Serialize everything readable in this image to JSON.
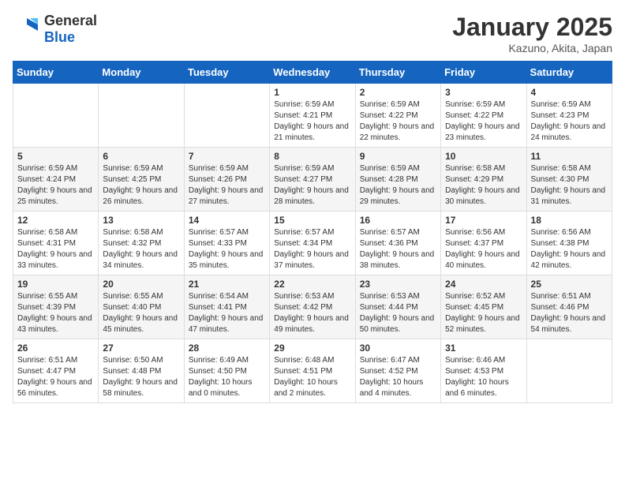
{
  "header": {
    "logo_general": "General",
    "logo_blue": "Blue",
    "title": "January 2025",
    "subtitle": "Kazuno, Akita, Japan"
  },
  "weekdays": [
    "Sunday",
    "Monday",
    "Tuesday",
    "Wednesday",
    "Thursday",
    "Friday",
    "Saturday"
  ],
  "weeks": [
    [
      {
        "day": "",
        "info": ""
      },
      {
        "day": "",
        "info": ""
      },
      {
        "day": "",
        "info": ""
      },
      {
        "day": "1",
        "info": "Sunrise: 6:59 AM\nSunset: 4:21 PM\nDaylight: 9 hours and 21 minutes."
      },
      {
        "day": "2",
        "info": "Sunrise: 6:59 AM\nSunset: 4:22 PM\nDaylight: 9 hours and 22 minutes."
      },
      {
        "day": "3",
        "info": "Sunrise: 6:59 AM\nSunset: 4:22 PM\nDaylight: 9 hours and 23 minutes."
      },
      {
        "day": "4",
        "info": "Sunrise: 6:59 AM\nSunset: 4:23 PM\nDaylight: 9 hours and 24 minutes."
      }
    ],
    [
      {
        "day": "5",
        "info": "Sunrise: 6:59 AM\nSunset: 4:24 PM\nDaylight: 9 hours and 25 minutes."
      },
      {
        "day": "6",
        "info": "Sunrise: 6:59 AM\nSunset: 4:25 PM\nDaylight: 9 hours and 26 minutes."
      },
      {
        "day": "7",
        "info": "Sunrise: 6:59 AM\nSunset: 4:26 PM\nDaylight: 9 hours and 27 minutes."
      },
      {
        "day": "8",
        "info": "Sunrise: 6:59 AM\nSunset: 4:27 PM\nDaylight: 9 hours and 28 minutes."
      },
      {
        "day": "9",
        "info": "Sunrise: 6:59 AM\nSunset: 4:28 PM\nDaylight: 9 hours and 29 minutes."
      },
      {
        "day": "10",
        "info": "Sunrise: 6:58 AM\nSunset: 4:29 PM\nDaylight: 9 hours and 30 minutes."
      },
      {
        "day": "11",
        "info": "Sunrise: 6:58 AM\nSunset: 4:30 PM\nDaylight: 9 hours and 31 minutes."
      }
    ],
    [
      {
        "day": "12",
        "info": "Sunrise: 6:58 AM\nSunset: 4:31 PM\nDaylight: 9 hours and 33 minutes."
      },
      {
        "day": "13",
        "info": "Sunrise: 6:58 AM\nSunset: 4:32 PM\nDaylight: 9 hours and 34 minutes."
      },
      {
        "day": "14",
        "info": "Sunrise: 6:57 AM\nSunset: 4:33 PM\nDaylight: 9 hours and 35 minutes."
      },
      {
        "day": "15",
        "info": "Sunrise: 6:57 AM\nSunset: 4:34 PM\nDaylight: 9 hours and 37 minutes."
      },
      {
        "day": "16",
        "info": "Sunrise: 6:57 AM\nSunset: 4:36 PM\nDaylight: 9 hours and 38 minutes."
      },
      {
        "day": "17",
        "info": "Sunrise: 6:56 AM\nSunset: 4:37 PM\nDaylight: 9 hours and 40 minutes."
      },
      {
        "day": "18",
        "info": "Sunrise: 6:56 AM\nSunset: 4:38 PM\nDaylight: 9 hours and 42 minutes."
      }
    ],
    [
      {
        "day": "19",
        "info": "Sunrise: 6:55 AM\nSunset: 4:39 PM\nDaylight: 9 hours and 43 minutes."
      },
      {
        "day": "20",
        "info": "Sunrise: 6:55 AM\nSunset: 4:40 PM\nDaylight: 9 hours and 45 minutes."
      },
      {
        "day": "21",
        "info": "Sunrise: 6:54 AM\nSunset: 4:41 PM\nDaylight: 9 hours and 47 minutes."
      },
      {
        "day": "22",
        "info": "Sunrise: 6:53 AM\nSunset: 4:42 PM\nDaylight: 9 hours and 49 minutes."
      },
      {
        "day": "23",
        "info": "Sunrise: 6:53 AM\nSunset: 4:44 PM\nDaylight: 9 hours and 50 minutes."
      },
      {
        "day": "24",
        "info": "Sunrise: 6:52 AM\nSunset: 4:45 PM\nDaylight: 9 hours and 52 minutes."
      },
      {
        "day": "25",
        "info": "Sunrise: 6:51 AM\nSunset: 4:46 PM\nDaylight: 9 hours and 54 minutes."
      }
    ],
    [
      {
        "day": "26",
        "info": "Sunrise: 6:51 AM\nSunset: 4:47 PM\nDaylight: 9 hours and 56 minutes."
      },
      {
        "day": "27",
        "info": "Sunrise: 6:50 AM\nSunset: 4:48 PM\nDaylight: 9 hours and 58 minutes."
      },
      {
        "day": "28",
        "info": "Sunrise: 6:49 AM\nSunset: 4:50 PM\nDaylight: 10 hours and 0 minutes."
      },
      {
        "day": "29",
        "info": "Sunrise: 6:48 AM\nSunset: 4:51 PM\nDaylight: 10 hours and 2 minutes."
      },
      {
        "day": "30",
        "info": "Sunrise: 6:47 AM\nSunset: 4:52 PM\nDaylight: 10 hours and 4 minutes."
      },
      {
        "day": "31",
        "info": "Sunrise: 6:46 AM\nSunset: 4:53 PM\nDaylight: 10 hours and 6 minutes."
      },
      {
        "day": "",
        "info": ""
      }
    ]
  ]
}
